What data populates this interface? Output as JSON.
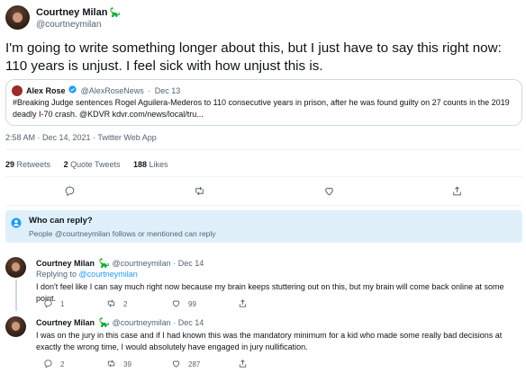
{
  "main_tweet": {
    "author_name": "Courtney Milan",
    "author_emoji": "🦕",
    "author_handle": "@courtneymilan",
    "text": "I'm going to write something longer about this, but I just have to say this right now: 110 years is unjust. I feel sick with how unjust this is.",
    "quote": {
      "author_name": "Alex Rose",
      "author_handle": "@AlexRoseNews",
      "date": "Dec 13",
      "text": "#Breaking Judge sentences Rogel Aguilera-Mederos to 110 consecutive years in prison, after he was found guilty on 27 counts in the 2019 deadly I-70 crash. @KDVR kdvr.com/news/local/tru..."
    },
    "timestamp": "2:58 AM · Dec 14, 2021 · Twitter Web App",
    "stats": {
      "retweets_count": "29",
      "retweets_label": "Retweets",
      "quotes_count": "2",
      "quotes_label": "Quote Tweets",
      "likes_count": "188",
      "likes_label": "Likes"
    }
  },
  "who_can_reply": {
    "title": "Who can reply?",
    "description": "People @courtneymilan follows or mentioned can reply"
  },
  "replies": [
    {
      "author_name": "Courtney Milan",
      "author_emoji": "🦕",
      "author_handle": "@courtneymilan",
      "date": "Dec 14",
      "replying_prefix": "Replying to",
      "replying_to": "@courtneymilan",
      "text": "I don't feel like I can say much right now because my brain keeps stuttering out on this, but my brain will come back online at some point.",
      "reply_count": "1",
      "retweet_count": "2",
      "like_count": "99"
    },
    {
      "author_name": "Courtney Milan",
      "author_emoji": "🦕",
      "author_handle": "@courtneymilan",
      "date": "Dec 14",
      "text": "I was on the jury in this case and if I had known this was the mandatory minimum for a kid who made some really bad decisions at exactly the wrong time, I would absolutely have engaged in jury nullification.",
      "reply_count": "2",
      "retweet_count": "39",
      "like_count": "287"
    }
  ],
  "icons": {
    "reply": "reply-icon",
    "retweet": "retweet-icon",
    "like": "heart-icon",
    "share": "share-icon",
    "verified": "verified-badge-icon",
    "who_can_reply": "user-circle-icon"
  },
  "colors": {
    "accent": "#1d9bf0",
    "muted": "#536471",
    "reply_box_bg": "#e0f0fb"
  }
}
